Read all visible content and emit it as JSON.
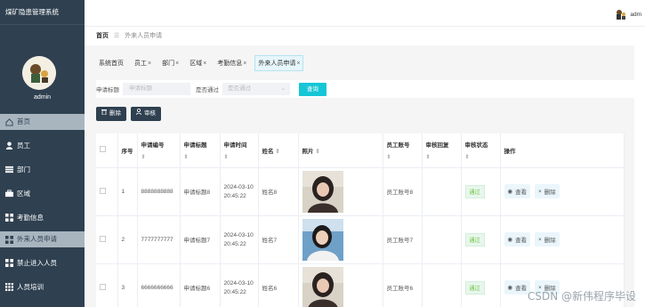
{
  "app": {
    "title": "煤矿隐患管理系统"
  },
  "user": {
    "name": "admin",
    "top_name": "adm"
  },
  "sidebar": {
    "items": [
      {
        "label": "首页",
        "icon": "home-icon",
        "active": true
      },
      {
        "label": "员工",
        "icon": "user-icon"
      },
      {
        "label": "部门",
        "icon": "list-icon"
      },
      {
        "label": "区域",
        "icon": "briefcase-icon"
      },
      {
        "label": "考勤信息",
        "icon": "grid-icon"
      },
      {
        "label": "外来人员申请",
        "icon": "grid-icon"
      },
      {
        "label": "禁止进入人员",
        "icon": "grid-icon"
      },
      {
        "label": "人员培训",
        "icon": "apps-icon"
      }
    ]
  },
  "breadcrumb": {
    "home": "首页",
    "separator": "☰",
    "current": "外来人员申请"
  },
  "tabs": [
    {
      "label": "系统首页",
      "closable": false
    },
    {
      "label": "员工",
      "closable": true
    },
    {
      "label": "部门",
      "closable": true
    },
    {
      "label": "区域",
      "closable": true
    },
    {
      "label": "考勤信息",
      "closable": true
    },
    {
      "label": "外来人员申请",
      "closable": true,
      "active": true
    }
  ],
  "tab_close": "×",
  "search": {
    "title_label": "申请标题",
    "title_placeholder": "申请标题",
    "pass_label": "是否通过",
    "pass_placeholder": "是否通过",
    "query_button": "查询"
  },
  "actions": {
    "delete": "删除",
    "review": "审核"
  },
  "table": {
    "columns": [
      "序号",
      "申请编号",
      "申请标题",
      "申请时间",
      "姓名",
      "照片",
      "员工账号",
      "审核回复",
      "审核状态",
      "操作"
    ],
    "sort_mark": "⇕",
    "rows": [
      {
        "index": "1",
        "code": "8888888888",
        "title": "申请标题8",
        "date": "2024-03-10",
        "time": "20:45:22",
        "name": "姓名8",
        "account": "员工账号8",
        "reply": "",
        "status": "通过"
      },
      {
        "index": "2",
        "code": "7777777777",
        "title": "申请标题7",
        "date": "2024-03-10",
        "time": "20:45:22",
        "name": "姓名7",
        "account": "员工账号7",
        "reply": "",
        "status": "通过"
      },
      {
        "index": "3",
        "code": "6666666666",
        "title": "申请标题6",
        "date": "2024-03-10",
        "time": "20:45:22",
        "name": "姓名6",
        "account": "员工账号6",
        "reply": "",
        "status": "通过"
      }
    ],
    "ops": {
      "view": "查看",
      "delete": "删除"
    }
  },
  "watermark": "CSDN @新伟程序毕设",
  "colors": {
    "sidebar": "#2f4050",
    "accent": "#16c6d6",
    "active_tab": "#e6f6fb",
    "status": "#67c23a"
  }
}
